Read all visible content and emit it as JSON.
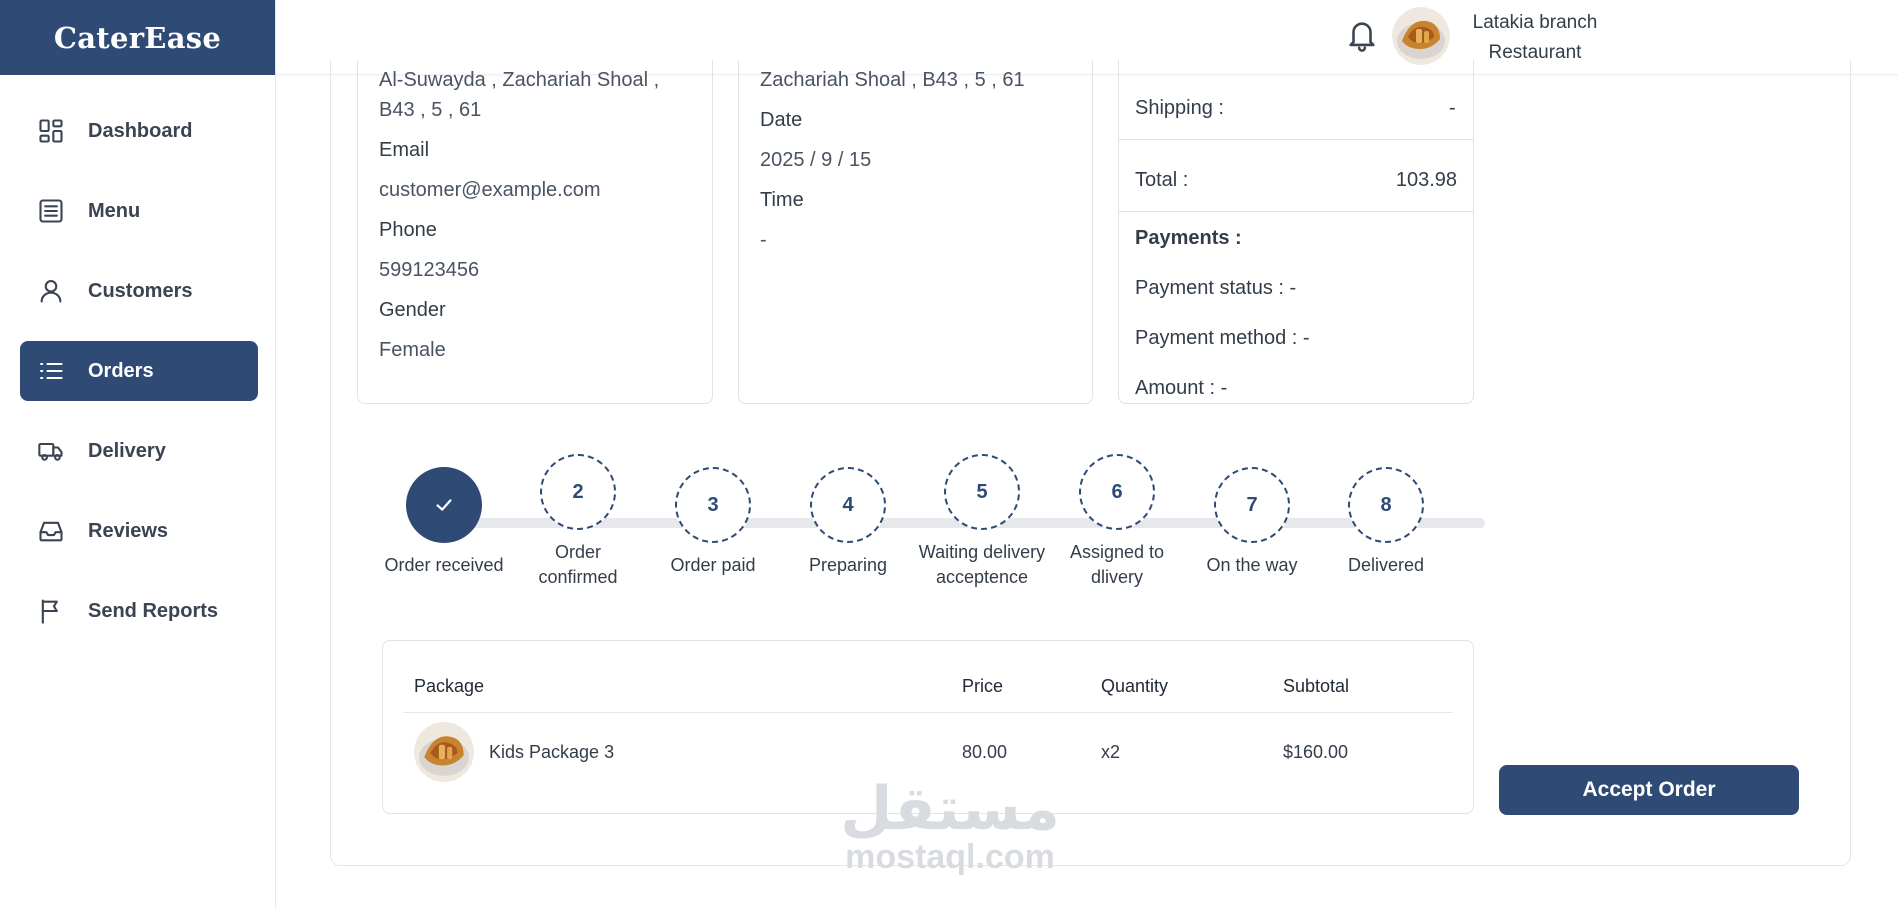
{
  "brand": {
    "name": "CaterEase"
  },
  "sidebar": {
    "items": [
      {
        "label": "Dashboard",
        "icon": "dashboard-icon"
      },
      {
        "label": "Menu",
        "icon": "menu-list-icon"
      },
      {
        "label": "Customers",
        "icon": "user-icon"
      },
      {
        "label": "Orders",
        "icon": "orders-list-icon",
        "active": true
      },
      {
        "label": "Delivery",
        "icon": "truck-icon"
      },
      {
        "label": "Reviews",
        "icon": "inbox-icon"
      },
      {
        "label": "Send Reports",
        "icon": "flag-icon"
      }
    ]
  },
  "header": {
    "branch_line1": "Latakia branch",
    "branch_line2": "Restaurant",
    "bell_icon": "bell-icon"
  },
  "customer_info": {
    "address_line1": "Al-Suwayda , Zachariah Shoal ,",
    "address_line2": "B43 , 5 , 61",
    "email_label": "Email",
    "email": "customer@example.com",
    "phone_label": "Phone",
    "phone": "599123456",
    "gender_label": "Gender",
    "gender": "Female"
  },
  "delivery_info": {
    "address": "Zachariah Shoal , B43 , 5 , 61",
    "date_label": "Date",
    "date": "2025 / 9 / 15",
    "time_label": "Time",
    "time": "-"
  },
  "summary": {
    "shipping_label": "Shipping :",
    "shipping_value": "-",
    "total_label": "Total :",
    "total_value": "103.98",
    "payments_heading": "Payments :",
    "payment_status": "Payment status : -",
    "payment_method": "Payment method : -",
    "amount": "Amount : -"
  },
  "steps": [
    {
      "number": "1",
      "label1": "Order received",
      "label2": "",
      "done": true
    },
    {
      "number": "2",
      "label1": "Order",
      "label2": "confirmed"
    },
    {
      "number": "3",
      "label1": "Order paid",
      "label2": ""
    },
    {
      "number": "4",
      "label1": "Preparing",
      "label2": ""
    },
    {
      "number": "5",
      "label1": "Waiting delivery",
      "label2": "acceptence"
    },
    {
      "number": "6",
      "label1": "Assigned to",
      "label2": "dlivery"
    },
    {
      "number": "7",
      "label1": "On the way",
      "label2": ""
    },
    {
      "number": "8",
      "label1": "Delivered",
      "label2": ""
    }
  ],
  "table": {
    "headers": {
      "package": "Package",
      "price": "Price",
      "quantity": "Quantity",
      "subtotal": "Subtotal"
    },
    "rows": [
      {
        "package": "Kids Package 3",
        "price": "80.00",
        "quantity": "x2",
        "subtotal": "$160.00"
      }
    ]
  },
  "actions": {
    "accept_label": "Accept Order"
  },
  "watermark": {
    "arabic": "مستقل",
    "latin": "mostaql.com"
  },
  "colors": {
    "primary": "#2f4b75",
    "text": "#333d4a",
    "border": "#dfe2e6"
  }
}
